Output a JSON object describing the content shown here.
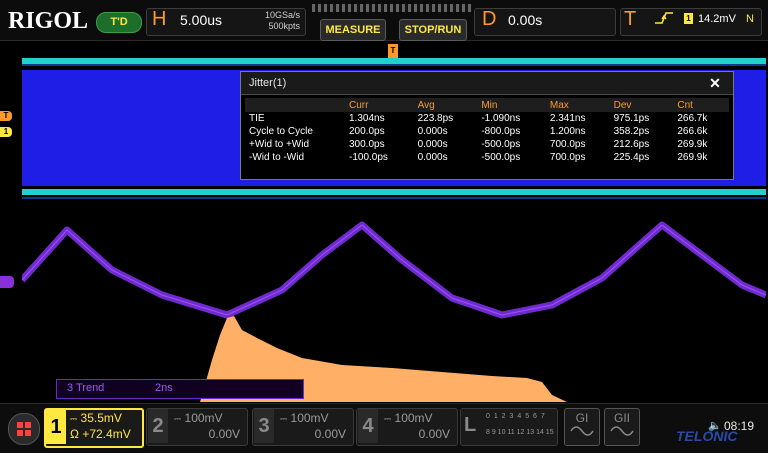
{
  "topbar": {
    "brand": "RIGOL",
    "run_state": "T'D",
    "horizontal": {
      "letter": "H",
      "timebase": "5.00us",
      "sample_rate": "10GSa/s",
      "memory_depth": "500kpts"
    },
    "measure_label": "MEASURE",
    "stoprun_label": "STOP/RUN",
    "delay": {
      "letter": "D",
      "value": "0.00s"
    },
    "trigger": {
      "letter": "T",
      "edge_icon": "rising-edge-icon",
      "source": "1",
      "level": "14.2mV",
      "mode": "N"
    }
  },
  "markers": {
    "trigger": "T",
    "ch1": "1",
    "top_trigger": "T"
  },
  "jitter": {
    "title": "Jitter(1)",
    "close_label": "✕",
    "columns": [
      "",
      "Curr",
      "Avg",
      "Min",
      "Max",
      "Dev",
      "Cnt"
    ],
    "rows": [
      [
        "TIE",
        "1.304ns",
        "223.8ps",
        "-1.090ns",
        "2.341ns",
        "975.1ps",
        "266.7k"
      ],
      [
        "Cycle to Cycle",
        "200.0ps",
        "0.000s",
        "-800.0ps",
        "1.200ns",
        "358.2ps",
        "266.6k"
      ],
      [
        "+Wid to +Wid",
        "300.0ps",
        "0.000s",
        "-500.0ps",
        "700.0ps",
        "212.6ps",
        "269.9k"
      ],
      [
        "-Wid to -Wid",
        "-100.0ps",
        "0.000s",
        "-500.0ps",
        "700.0ps",
        "225.4ps",
        "269.9k"
      ]
    ]
  },
  "trend": {
    "name": "3 Trend",
    "scale": "2ns"
  },
  "channels": {
    "ch1": {
      "number": "1",
      "scale": "35.5mV",
      "offset": "+72.4mV",
      "coupling_icon": "dc-coupling-icon",
      "impedance": "Ω"
    },
    "ch2": {
      "number": "2",
      "scale": "100mV",
      "offset": "0.00V"
    },
    "ch3": {
      "number": "3",
      "scale": "100mV",
      "offset": "0.00V"
    },
    "ch4": {
      "number": "4",
      "scale": "100mV",
      "offset": "0.00V"
    }
  },
  "logic": {
    "letter": "L",
    "top_row": "0 1 2 3 4 5 6 7",
    "bottom_row": "8 9 10 11 12 13 14 15"
  },
  "generators": {
    "g1": "GI",
    "g2": "GII"
  },
  "footer_brand": "TELONIC",
  "clock": "08:19",
  "colors": {
    "ch1": "#ffe840",
    "trigger": "#ff9a2a",
    "math": "#8a30d8",
    "histogram": "#ffb066",
    "digital_fill": "#1e1ee6",
    "digital_edge": "#1fd2d0"
  }
}
